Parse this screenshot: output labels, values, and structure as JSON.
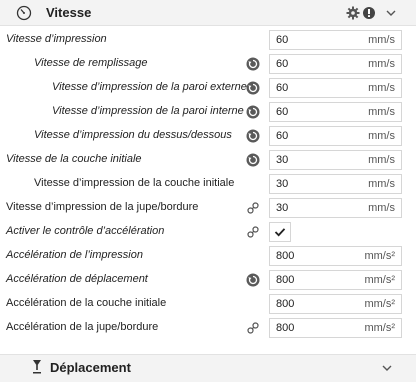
{
  "header": {
    "title": "Vitesse",
    "icons": [
      "speedometer-icon",
      "gear-icon",
      "info-icon",
      "chevron-down-icon"
    ]
  },
  "settings": [
    {
      "label": "Vitesse d’impression",
      "value": "60",
      "unit": "mm/s",
      "italic": true,
      "icon": ""
    },
    {
      "label": "Vitesse de remplissage",
      "value": "60",
      "unit": "mm/s",
      "italic": true,
      "icon": "reset-icon"
    },
    {
      "label": "Vitesse d’impression de la paroi externe",
      "value": "60",
      "unit": "mm/s",
      "italic": true,
      "icon": "reset-icon"
    },
    {
      "label": "Vitesse d’impression de la paroi interne",
      "value": "60",
      "unit": "mm/s",
      "italic": true,
      "icon": "reset-icon"
    },
    {
      "label": "Vitesse d’impression du dessus/dessous",
      "value": "60",
      "unit": "mm/s",
      "italic": true,
      "icon": "reset-icon"
    },
    {
      "label": "Vitesse de la couche initiale",
      "value": "30",
      "unit": "mm/s",
      "italic": true,
      "icon": "reset-icon"
    },
    {
      "label": "Vitesse d’impression de la couche initiale",
      "value": "30",
      "unit": "mm/s",
      "italic": false,
      "icon": ""
    },
    {
      "label": "Vitesse d’impression de la jupe/bordure",
      "value": "30",
      "unit": "mm/s",
      "italic": false,
      "icon": "link-icon"
    },
    {
      "label": "Activer le contrôle d’accélération",
      "value": "",
      "unit": "",
      "italic": true,
      "icon": "link-icon",
      "checked": true
    },
    {
      "label": "Accélération de l’impression",
      "value": "800",
      "unit": "mm/s²",
      "italic": true,
      "icon": ""
    },
    {
      "label": "Accélération de déplacement",
      "value": "800",
      "unit": "mm/s²",
      "italic": true,
      "icon": "reset-icon"
    },
    {
      "label": "Accélération de la couche initiale",
      "value": "800",
      "unit": "mm/s²",
      "italic": false,
      "icon": ""
    },
    {
      "label": "Accélération de la jupe/bordure",
      "value": "800",
      "unit": "mm/s²",
      "italic": false,
      "icon": "link-icon"
    }
  ],
  "next_section": {
    "title": "Déplacement",
    "icons": [
      "travel-icon",
      "chevron-down-icon"
    ]
  },
  "colors": {
    "header_bg": "#f3f3f3",
    "field_border": "#d6d6d6",
    "icon_dark": "#555555"
  }
}
